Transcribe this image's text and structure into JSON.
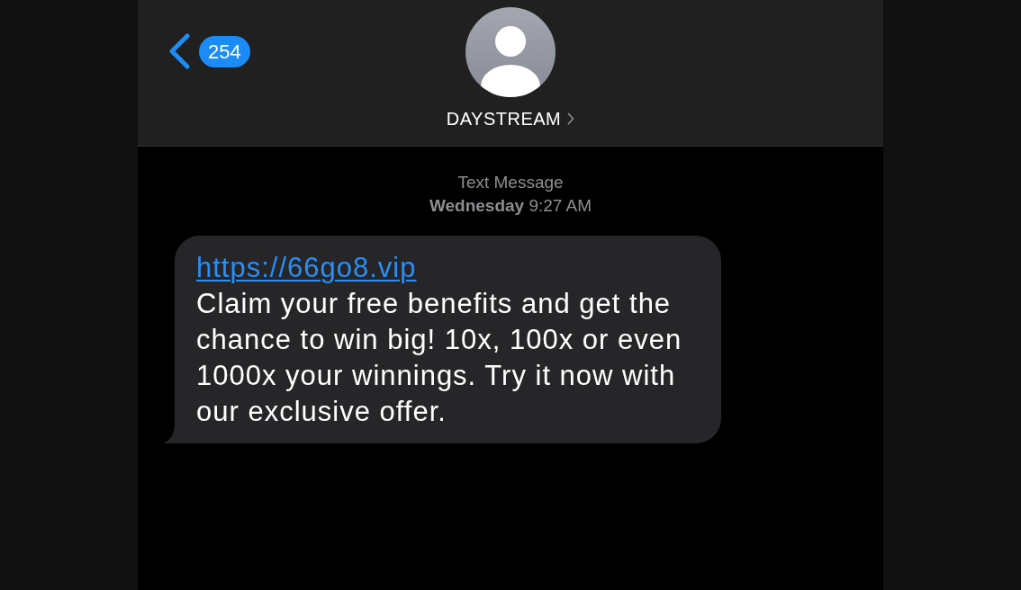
{
  "header": {
    "back_count": "254",
    "contact_name": "DAYSTREAM"
  },
  "conversation": {
    "service_label": "Text Message",
    "timestamp": "**Wednesday** 9:27 AM",
    "messages": [
      {
        "kind": "received",
        "link": "https://66go8.vip",
        "text": "Claim your free benefits and get the chance to win big! 10x, 100x or even 1000x your winnings. Try it now with our exclusive offer."
      }
    ]
  }
}
